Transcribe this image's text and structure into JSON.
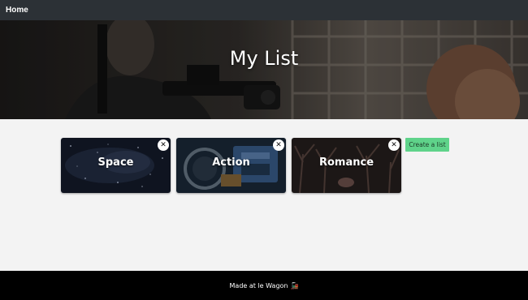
{
  "navbar": {
    "home_label": "Home"
  },
  "hero": {
    "title": "My List"
  },
  "lists": [
    {
      "name": "Space",
      "close_symbol": "✕"
    },
    {
      "name": "Action",
      "close_symbol": "✕"
    },
    {
      "name": "Romance",
      "close_symbol": "✕"
    }
  ],
  "create_button": {
    "label": "Create a list"
  },
  "footer": {
    "text": "Made at le Wagon",
    "emoji": "🚂"
  },
  "colors": {
    "navbar_bg": "#2c3136",
    "page_bg": "#f3f3f3",
    "create_button_bg": "#5fd38a",
    "footer_bg": "#000000"
  }
}
